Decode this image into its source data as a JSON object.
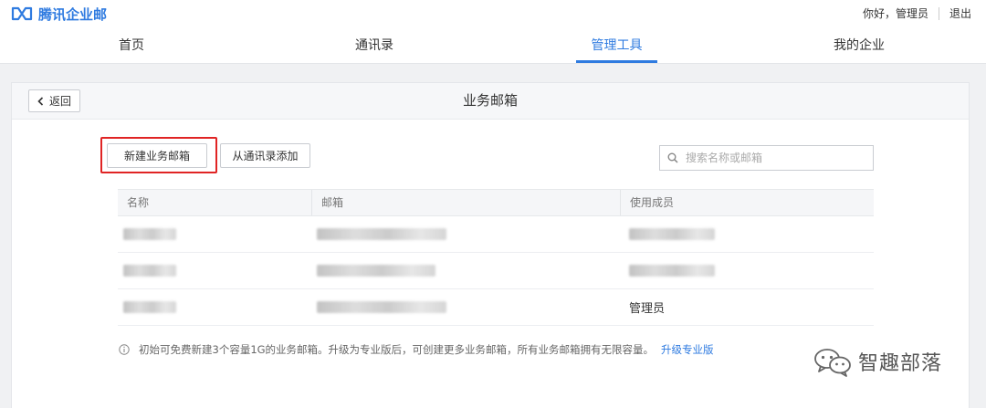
{
  "brand": {
    "name": "腾讯企业邮",
    "color": "#2f7be0"
  },
  "user": {
    "greeting": "你好，管理员",
    "logout": "退出"
  },
  "nav": {
    "items": [
      {
        "label": "首页"
      },
      {
        "label": "通讯录"
      },
      {
        "label": "管理工具",
        "active": true
      },
      {
        "label": "我的企业"
      }
    ]
  },
  "panel": {
    "back_label": "返回",
    "title": "业务邮箱",
    "new_button": "新建业务邮箱",
    "add_from_contacts": "从通讯录添加",
    "search_placeholder": "搜索名称或邮箱"
  },
  "table": {
    "columns": [
      "名称",
      "邮箱",
      "使用成员"
    ],
    "rows": [
      {
        "name": "",
        "email": "",
        "members": ""
      },
      {
        "name": "",
        "email": "",
        "members": ""
      },
      {
        "name": "",
        "email": "",
        "members": "管理员"
      }
    ]
  },
  "note": {
    "text": "初始可免费新建3个容量1G的业务邮箱。升级为专业版后，可创建更多业务邮箱，所有业务邮箱拥有无限容量。",
    "link": "升级专业版"
  },
  "watermark": {
    "text": "智趣部落"
  },
  "colors": {
    "accent": "#2f7be0",
    "highlight": "#e02424"
  },
  "icons": [
    "brand-logo-icon",
    "chevron-left-icon",
    "search-icon",
    "info-icon",
    "wechat-icon"
  ]
}
